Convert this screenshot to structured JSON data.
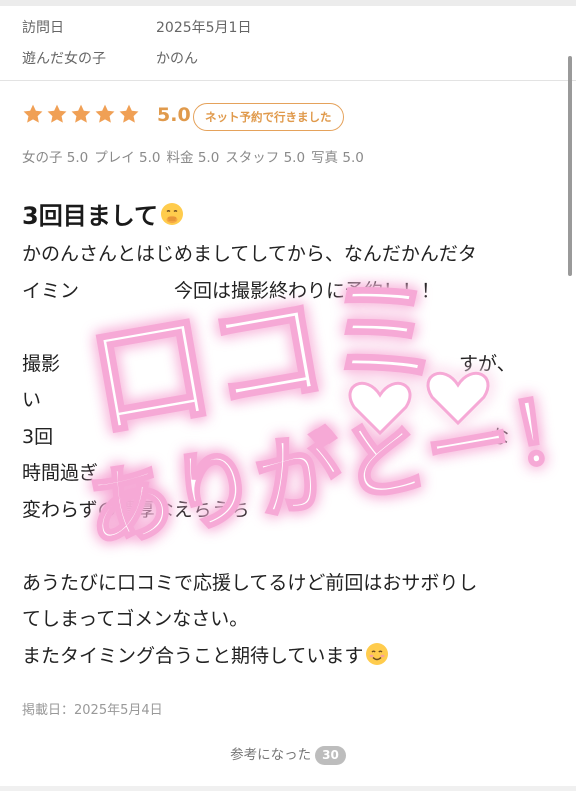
{
  "visit": {
    "date_label": "訪問日",
    "date_value": "2025年5月1日",
    "girl_label": "遊んだ女の子",
    "girl_value": "かのん"
  },
  "rating": {
    "stars": 5,
    "max_stars": 5,
    "score": "5.0",
    "badge": "ネット予約で行きました",
    "star_color": "#f0a055",
    "subscores": [
      "女の子 5.0",
      "プレイ 5.0",
      "料金 5.0",
      "スタッフ 5.0",
      "写真 5.0"
    ]
  },
  "review": {
    "title": "3回目まして",
    "title_emoji": "hand-over-mouth-emoji",
    "lines": [
      "かのんさんとはじめましてしてから、なんだかんだタ",
      "イミン　　　　　今回は撮影終わりに予約！！！",
      "",
      "撮影　　　　　　　　　　　　　　　　　　　　　すが、",
      "い",
      "3回　　　　　　　　　　　　　　　　　　　　　　　な",
      "時間過ぎ",
      "変わらずの濃厚なえちえち",
      "",
      "あうたびに口コミで応援してるけど前回はおサボりし",
      "てしまってゴメンなさい。",
      "またタイミング合うこと期待しています"
    ],
    "closing_emoji": "smiling-face-emoji",
    "posted": "掲載日：2025年5月4日"
  },
  "overlay_stamp": {
    "line1": "口コミ",
    "line2": "ありがとー！",
    "color": "#f4a6d2"
  },
  "helpful": {
    "label": "参考になった",
    "count": "30"
  }
}
